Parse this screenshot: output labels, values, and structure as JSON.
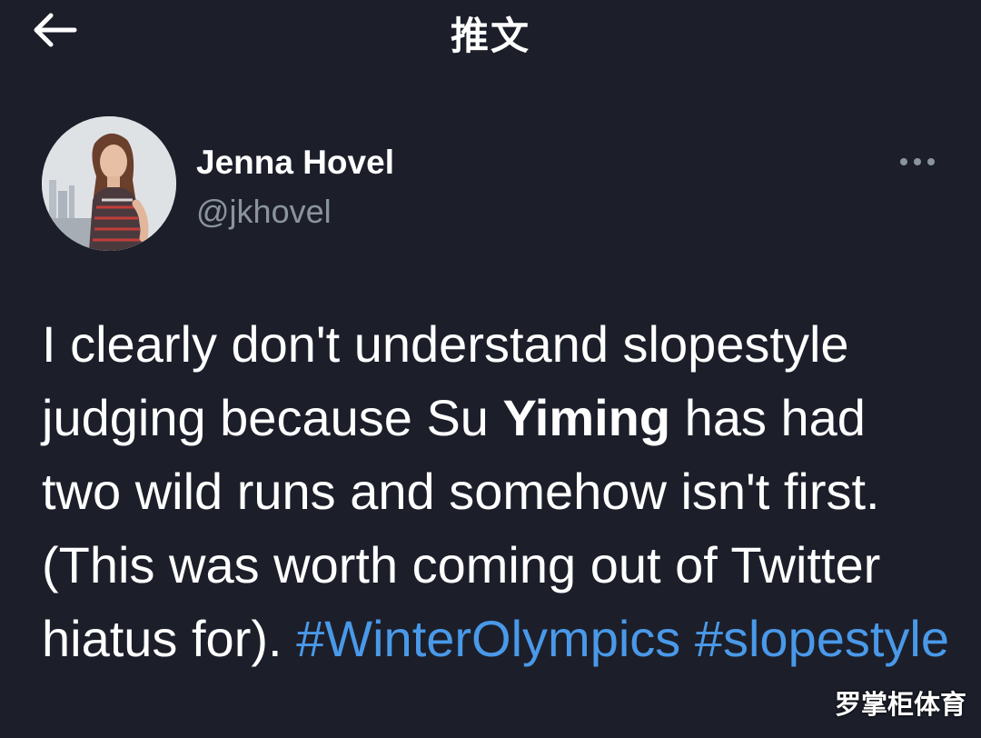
{
  "header": {
    "title": "推文",
    "back_icon": "arrow-left-icon"
  },
  "author": {
    "display_name": "Jenna Hovel",
    "handle": "@jkhovel",
    "more_icon": "more-horizontal-icon"
  },
  "tweet": {
    "text_before": "I clearly don't understand slopestyle judging because Su ",
    "highlight": "Yiming",
    "text_after": " has had two wild runs and somehow isn't first. (This was worth coming out of Twitter hiatus for). ",
    "hashtags": [
      "#WinterOlympics",
      "#slopestyle"
    ]
  },
  "watermark": "罗掌柜体育",
  "colors": {
    "background": "#1c1f2a",
    "text": "#ffffff",
    "secondary_text": "#8b949e",
    "link": "#4a99e9"
  }
}
